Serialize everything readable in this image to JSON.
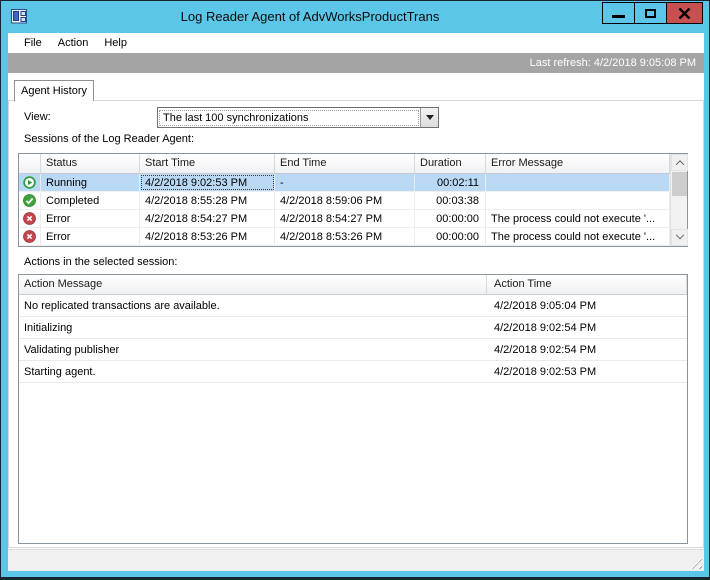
{
  "window": {
    "title": "Log Reader Agent of AdvWorksProductTrans"
  },
  "menu": {
    "items": [
      {
        "label": "File"
      },
      {
        "label": "Action"
      },
      {
        "label": "Help"
      }
    ]
  },
  "refresh": {
    "text": "Last refresh: 4/2/2018 9:05:08 PM"
  },
  "tabs": [
    {
      "label": "Agent History"
    }
  ],
  "view": {
    "label": "View:",
    "selected_option": "The last 100 synchronizations"
  },
  "sessions": {
    "label": "Sessions of the Log Reader Agent:",
    "columns": [
      "",
      "Status",
      "Start Time",
      "End Time",
      "Duration",
      "Error Message"
    ],
    "rows": [
      {
        "icon": "running-icon",
        "status": "Running",
        "start": "4/2/2018 9:02:53 PM",
        "end": "-",
        "duration": "00:02:11",
        "error": "",
        "selected": true
      },
      {
        "icon": "completed-icon",
        "status": "Completed",
        "start": "4/2/2018 8:55:28 PM",
        "end": "4/2/2018 8:59:06 PM",
        "duration": "00:03:38",
        "error": "",
        "selected": false
      },
      {
        "icon": "error-icon",
        "status": "Error",
        "start": "4/2/2018 8:54:27 PM",
        "end": "4/2/2018 8:54:27 PM",
        "duration": "00:00:00",
        "error": "The process could not execute '...",
        "selected": false
      },
      {
        "icon": "error-icon",
        "status": "Error",
        "start": "4/2/2018 8:53:26 PM",
        "end": "4/2/2018 8:53:26 PM",
        "duration": "00:00:00",
        "error": "The process could not execute '...",
        "selected": false
      }
    ]
  },
  "actions": {
    "label": "Actions in the selected session:",
    "columns": [
      "Action Message",
      "Action Time"
    ],
    "rows": [
      {
        "message": "No replicated transactions are available.",
        "time": "4/2/2018 9:05:04 PM"
      },
      {
        "message": "Initializing",
        "time": "4/2/2018 9:02:54 PM"
      },
      {
        "message": "Validating publisher",
        "time": "4/2/2018 9:02:54 PM"
      },
      {
        "message": "Starting agent.",
        "time": "4/2/2018 9:02:53 PM"
      }
    ]
  },
  "colors": {
    "titlebar": "#5bc6e8",
    "close_button": "#c75050",
    "toolbar_gray": "#a4a4a4",
    "selected_row": "#b9d9f5",
    "running": "#2e9b3f",
    "completed": "#3fa33c",
    "error": "#c2454f"
  }
}
